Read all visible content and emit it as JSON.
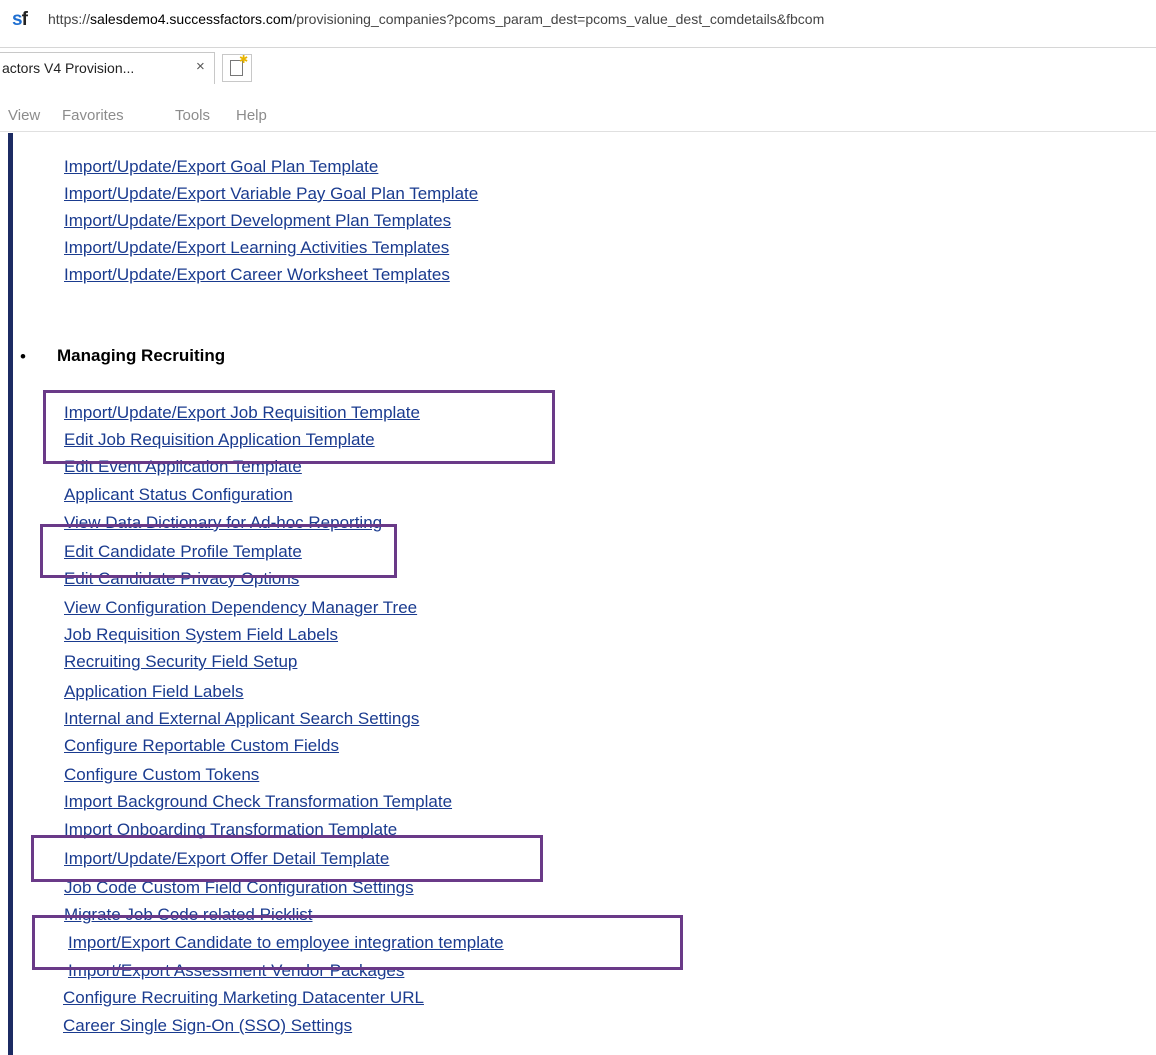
{
  "browser": {
    "logo_s": "s",
    "logo_f": "f",
    "url_prefix": "https://",
    "url_host": "salesdemo4.successfactors.com",
    "url_rest": "/provisioning_companies?pcoms_param_dest=pcoms_value_dest_comdetails&fbcom",
    "tab_title": "actors V4 Provision...",
    "tab_close": "×",
    "menu": [
      "View",
      "Favorites",
      "Tools",
      "Help"
    ]
  },
  "goal_links": [
    "Import/Update/Export Goal Plan Template",
    "Import/Update/Export Variable Pay Goal Plan Template",
    "Import/Update/Export Development Plan Templates",
    "Import/Update/Export Learning Activities Templates",
    "Import/Update/Export Career Worksheet Templates"
  ],
  "recruiting": {
    "bullet": "•",
    "heading": "Managing Recruiting",
    "links": [
      "Import/Update/Export Job Requisition Template",
      "Edit Job Requisition Application Template",
      "Edit Event Application Template",
      "Applicant Status Configuration",
      "View Data Dictionary for Ad-hoc Reporting",
      "Edit Candidate Profile Template",
      "Edit Candidate Privacy Options",
      "View Configuration Dependency Manager Tree",
      "Job Requisition System Field Labels",
      "Recruiting Security Field Setup",
      "Application Field Labels",
      "Internal and External Applicant Search Settings",
      "Configure Reportable Custom Fields",
      "Configure Custom Tokens",
      "Import Background Check Transformation Template",
      "Import Onboarding Transformation Template",
      "Import/Update/Export Offer Detail Template",
      "Job Code Custom Field Configuration Settings",
      "Migrate Job Code related Picklist",
      "Import/Export Candidate to employee integration template",
      "Import/Export Assessment Vendor Packages",
      "Configure Recruiting Marketing Datacenter URL",
      "Career Single Sign-On (SSO) Settings"
    ]
  },
  "colors": {
    "link": "#1a3b8f",
    "highlight_box": "#6a3a88",
    "side_bar": "#1c2b63"
  }
}
